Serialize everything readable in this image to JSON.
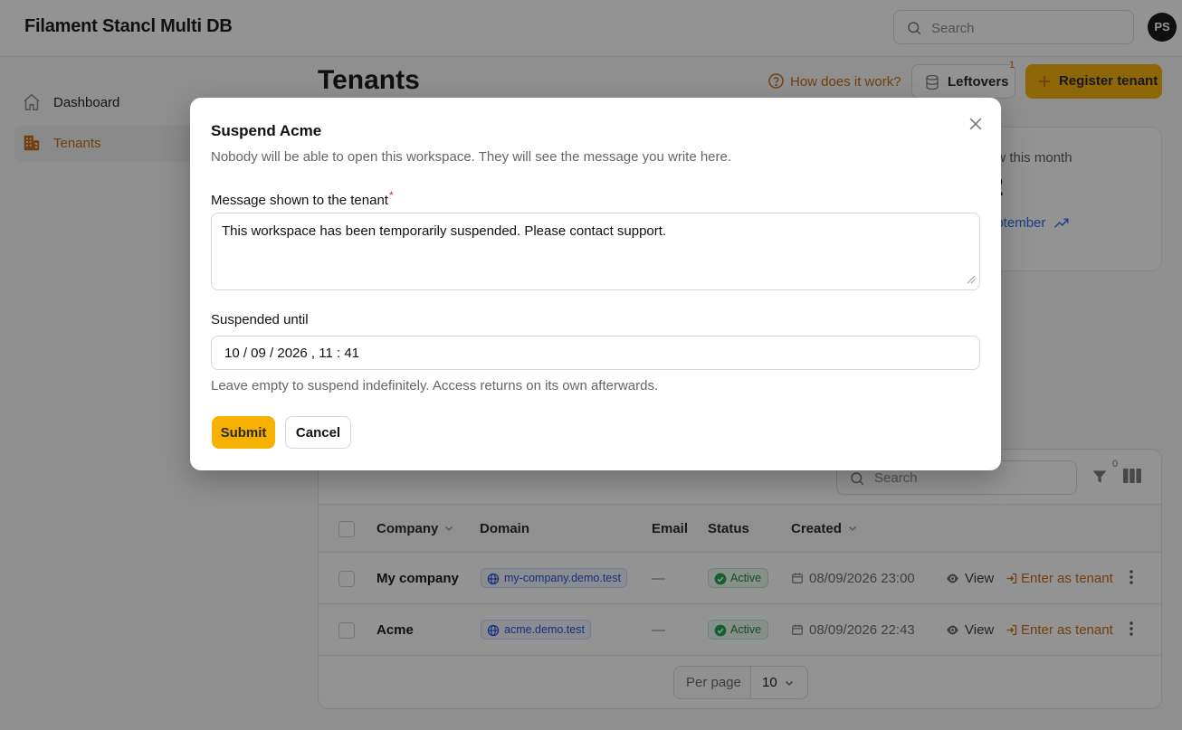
{
  "app": {
    "title": "Filament Stancl Multi DB"
  },
  "topbar": {
    "search_placeholder": "Search",
    "avatar_initials": "PS"
  },
  "sidebar": {
    "items": [
      {
        "label": "Dashboard",
        "icon": "home-icon",
        "active": false
      },
      {
        "label": "Tenants",
        "icon": "building-office-icon",
        "active": true
      }
    ]
  },
  "header": {
    "title": "Tenants",
    "how_link": "How does it work?",
    "leftovers_label": "Leftovers",
    "leftovers_badge": "1",
    "register_label": "Register tenant"
  },
  "stat": {
    "label": "ew this month",
    "value": "2",
    "description": "eptember"
  },
  "table": {
    "search_placeholder": "Search",
    "filter_count": "0",
    "columns": [
      "Company",
      "Domain",
      "Email",
      "Status",
      "Created"
    ],
    "rows": [
      {
        "company": "My company",
        "domain": "my-company.demo.test",
        "email": "—",
        "status": "Active",
        "created": "08/09/2026 23:00",
        "view": "View",
        "enter": "Enter as tenant"
      },
      {
        "company": "Acme",
        "domain": "acme.demo.test",
        "email": "—",
        "status": "Active",
        "created": "08/09/2026 22:43",
        "view": "View",
        "enter": "Enter as tenant"
      }
    ],
    "per_page_label": "Per page",
    "per_page_value": "10"
  },
  "modal": {
    "title": "Suspend Acme",
    "description": "Nobody will be able to open this workspace. They will see the message you write here.",
    "message_label": "Message shown to the tenant",
    "required_mark": "*",
    "message_value": "This workspace has been temporarily suspended. Please contact support.",
    "until_label": "Suspended until",
    "until_value": "10 / 09 / 2026 ,  11 : 41",
    "hint": "Leave empty to suspend indefinitely. Access returns on its own afterwards.",
    "submit_label": "Submit",
    "cancel_label": "Cancel"
  },
  "colors": {
    "accent": "#f5b000",
    "accent_text": "#c2690d",
    "link": "#2563eb",
    "success": "#15803d"
  }
}
